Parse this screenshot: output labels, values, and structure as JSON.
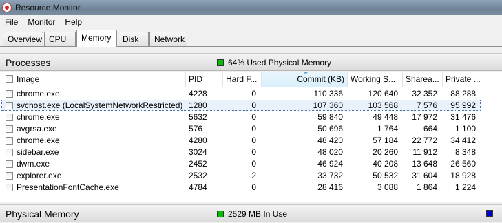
{
  "window": {
    "title": "Resource Monitor"
  },
  "menu": [
    "File",
    "Monitor",
    "Help"
  ],
  "tabs": [
    "Overview",
    "CPU",
    "Memory",
    "Disk",
    "Network"
  ],
  "active_tab": "Memory",
  "processes": {
    "title": "Processes",
    "status_text": "64% Used Physical Memory",
    "status_color": "#00c000",
    "columns": [
      "Image",
      "PID",
      "Hard F...",
      "Commit (KB)",
      "Working S...",
      "Sharea...",
      "Private ..."
    ],
    "sorted_column": "Commit (KB)",
    "rows": [
      {
        "image": "chrome.exe",
        "pid": "4228",
        "hard": "0",
        "commit": "110 336",
        "working": "120 640",
        "shareable": "32 352",
        "private": "88 288",
        "selected": false
      },
      {
        "image": "svchost.exe (LocalSystemNetworkRestricted)",
        "pid": "1280",
        "hard": "0",
        "commit": "107 360",
        "working": "103 568",
        "shareable": "7 576",
        "private": "95 992",
        "selected": true
      },
      {
        "image": "chrome.exe",
        "pid": "5632",
        "hard": "0",
        "commit": "59 840",
        "working": "49 448",
        "shareable": "17 972",
        "private": "31 476",
        "selected": false
      },
      {
        "image": "avgrsa.exe",
        "pid": "576",
        "hard": "0",
        "commit": "50 696",
        "working": "1 764",
        "shareable": "664",
        "private": "1 100",
        "selected": false
      },
      {
        "image": "chrome.exe",
        "pid": "4280",
        "hard": "0",
        "commit": "48 420",
        "working": "57 184",
        "shareable": "22 772",
        "private": "34 412",
        "selected": false
      },
      {
        "image": "sidebar.exe",
        "pid": "3024",
        "hard": "0",
        "commit": "48 020",
        "working": "20 260",
        "shareable": "11 912",
        "private": "8 348",
        "selected": false
      },
      {
        "image": "dwm.exe",
        "pid": "2452",
        "hard": "0",
        "commit": "46 924",
        "working": "40 208",
        "shareable": "13 648",
        "private": "26 560",
        "selected": false
      },
      {
        "image": "explorer.exe",
        "pid": "2532",
        "hard": "2",
        "commit": "33 732",
        "working": "50 532",
        "shareable": "31 604",
        "private": "18 928",
        "selected": false
      },
      {
        "image": "PresentationFontCache.exe",
        "pid": "4784",
        "hard": "0",
        "commit": "28 416",
        "working": "3 088",
        "shareable": "1 864",
        "private": "1 224",
        "selected": false
      }
    ]
  },
  "physical_memory": {
    "title": "Physical Memory",
    "status_text": "2529 MB In Use",
    "status_color": "#00c000",
    "legend_color": "#0000cc"
  }
}
